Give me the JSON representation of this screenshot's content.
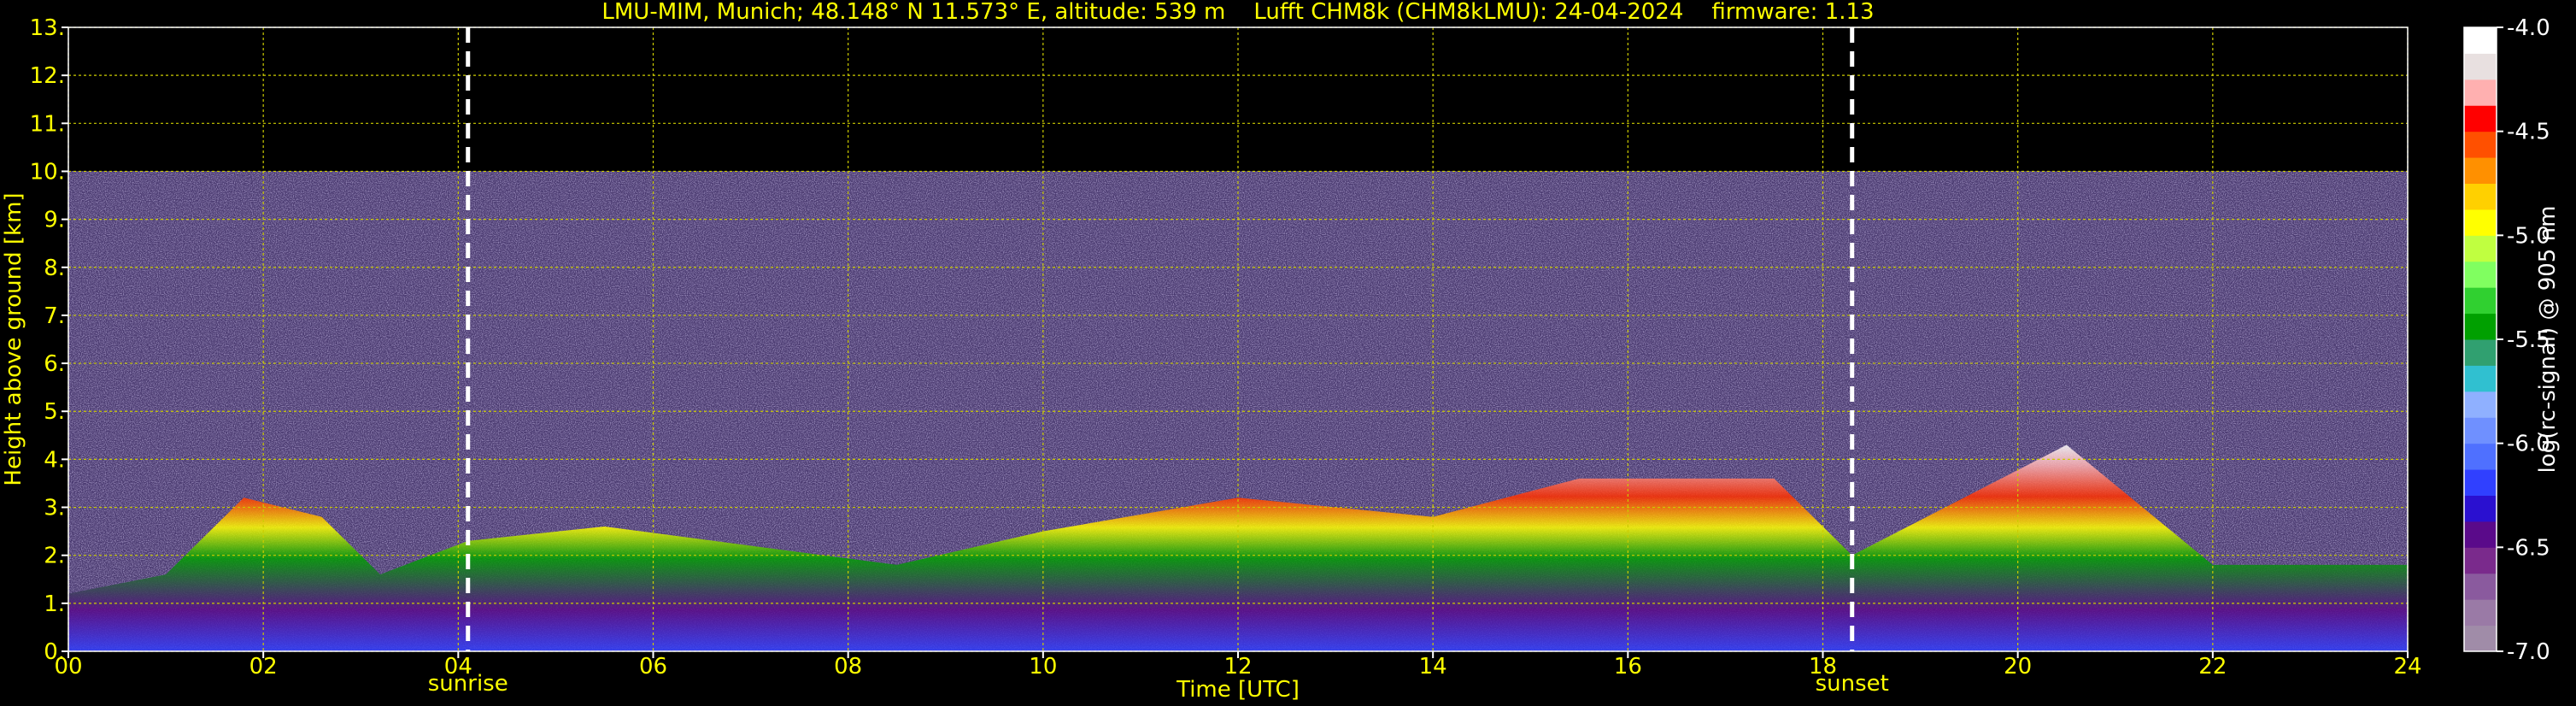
{
  "chart_data": {
    "type": "heatmap",
    "title": "LMU-MIM, Munich; 48.148° N 11.573° E, altitude: 539 m    Lufft CHM8k (CHM8kLMU): 24-04-2024    firmware: 1.13",
    "xlabel": "Time [UTC]",
    "ylabel": "Height above ground [km]",
    "xlim": [
      0,
      24
    ],
    "ylim": [
      0,
      13
    ],
    "xticks": [
      "00",
      "02",
      "04",
      "06",
      "08",
      "10",
      "12",
      "14",
      "16",
      "18",
      "20",
      "22",
      "24"
    ],
    "yticks": [
      "0.",
      "1.",
      "2.",
      "3.",
      "4.",
      "5.",
      "6.",
      "7.",
      "8.",
      "9.",
      "10.",
      "11.",
      "12.",
      "13."
    ],
    "grid": true,
    "measurement_top_km": 10,
    "markers": [
      {
        "label": "sunrise",
        "time": 4.1
      },
      {
        "label": "sunset",
        "time": 18.3
      }
    ],
    "colorbar": {
      "label": "log(rc-signal) @ 905 nm",
      "ticks": [
        "-4.0",
        "-4.5",
        "-5.0",
        "-5.5",
        "-6.0",
        "-6.5",
        "-7.0"
      ],
      "range": [
        -7.0,
        -4.0
      ],
      "colors": [
        "#a08ca8",
        "#9a7aa6",
        "#8a5a9e",
        "#7a2a8c",
        "#5a0a8a",
        "#2a10d0",
        "#3040ff",
        "#4f70ff",
        "#6f90ff",
        "#8fb0ff",
        "#30c0d0",
        "#30a070",
        "#00a000",
        "#30d030",
        "#80ff60",
        "#c0ff40",
        "#ffff00",
        "#ffd000",
        "#ff9000",
        "#ff5000",
        "#ff0000",
        "#ffb0b0",
        "#e8e0e0",
        "#ffffff"
      ]
    },
    "layer_tops_km": [
      {
        "t": 0,
        "h": 1.2
      },
      {
        "t": 1,
        "h": 1.6
      },
      {
        "t": 1.8,
        "h": 3.2
      },
      {
        "t": 2.6,
        "h": 2.8
      },
      {
        "t": 3.2,
        "h": 1.6
      },
      {
        "t": 4.1,
        "h": 2.3
      },
      {
        "t": 5.5,
        "h": 2.6
      },
      {
        "t": 7.0,
        "h": 2.2
      },
      {
        "t": 8.5,
        "h": 1.8
      },
      {
        "t": 10,
        "h": 2.5
      },
      {
        "t": 12,
        "h": 3.2
      },
      {
        "t": 14,
        "h": 2.8
      },
      {
        "t": 15.5,
        "h": 3.6
      },
      {
        "t": 17.5,
        "h": 3.6
      },
      {
        "t": 18.3,
        "h": 2.0
      },
      {
        "t": 20.5,
        "h": 4.3
      },
      {
        "t": 22,
        "h": 1.8
      },
      {
        "t": 24,
        "h": 1.8
      }
    ]
  }
}
